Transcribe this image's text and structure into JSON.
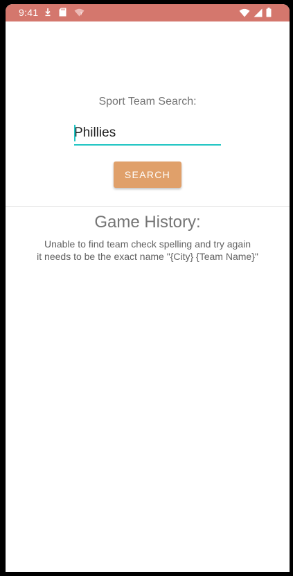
{
  "status_bar": {
    "time": "9:41",
    "icons_left": [
      "download-icon",
      "sd-card-icon",
      "wifi-question-icon"
    ],
    "icons_right": [
      "wifi-icon",
      "signal-icon",
      "battery-icon"
    ],
    "background_color": "#d4776d"
  },
  "search": {
    "label": "Sport Team Search:",
    "input_value": "Phillies",
    "button_label": "SEARCH",
    "accent_color": "#20c5c3",
    "button_color": "#e0a06a"
  },
  "history": {
    "title": "Game History:",
    "message_line1": "Unable to find team check spelling and try again",
    "message_line2": "it needs to be the exact name \"{City} {Team Name}\""
  }
}
